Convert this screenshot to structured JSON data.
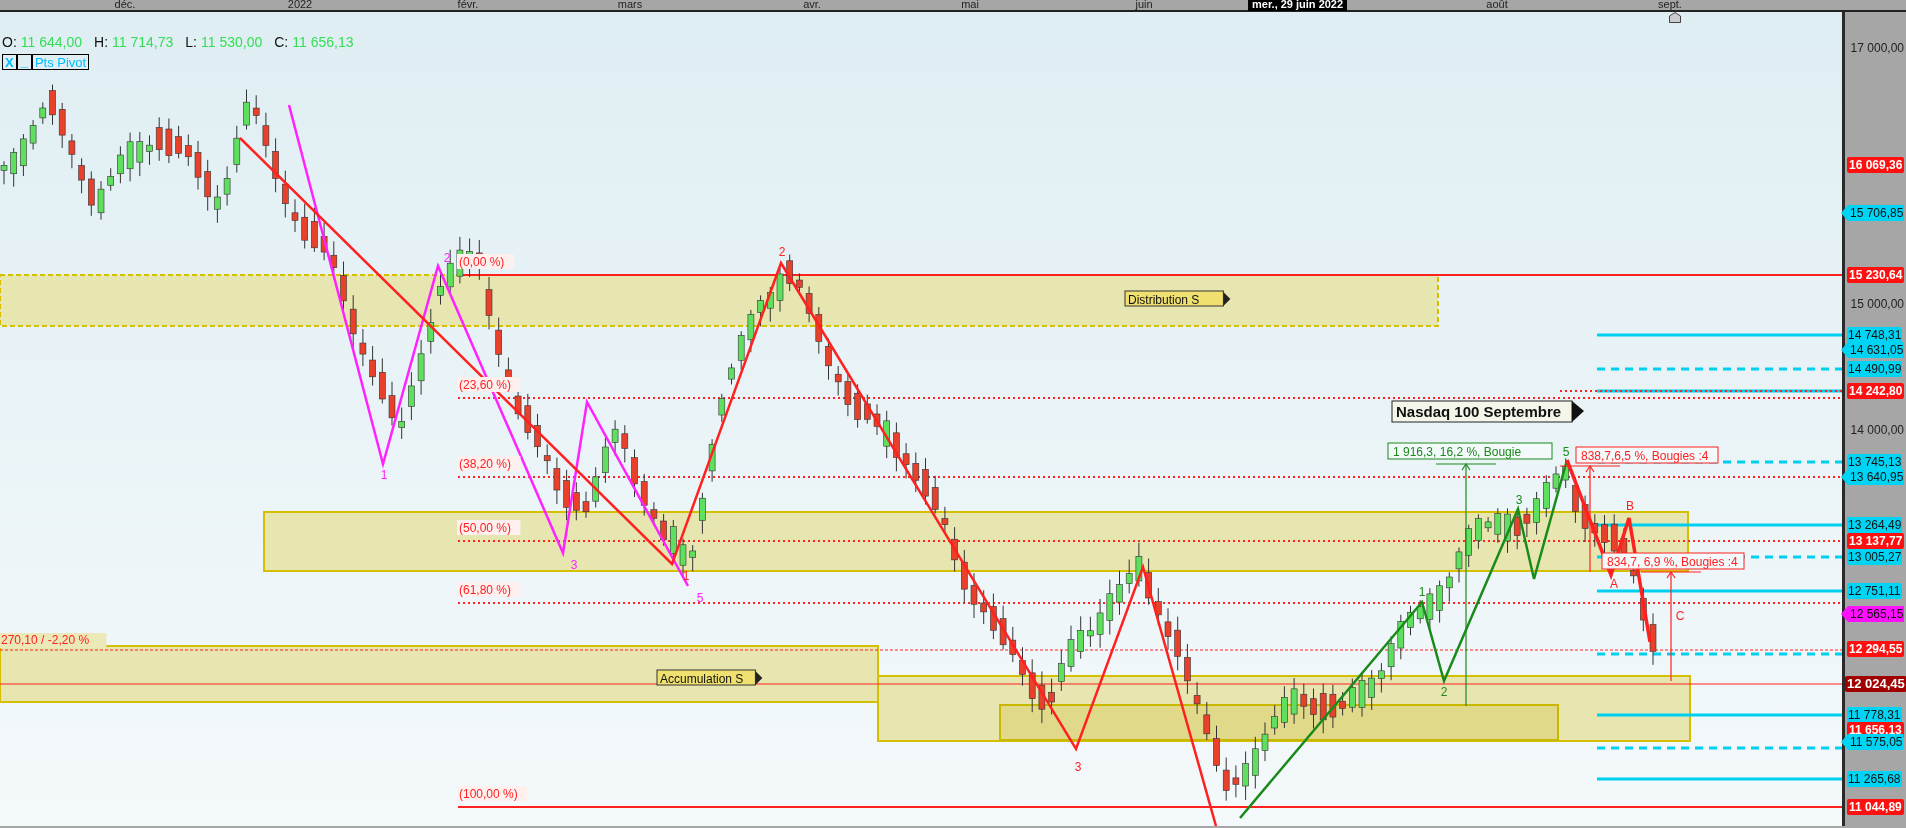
{
  "time_axis": {
    "labels": [
      "déc.",
      "2022",
      "févr.",
      "mars",
      "avr.",
      "mai",
      "juin",
      "août",
      "sept."
    ],
    "cursor_date": "mer., 29 juin 2022"
  },
  "ohlc": [
    {
      "label": "O:",
      "value": "11 644,00"
    },
    {
      "label": "H:",
      "value": "11 714,73"
    },
    {
      "label": "L:",
      "value": "11 530,00"
    },
    {
      "label": "C:",
      "value": "11 656,13"
    }
  ],
  "indicator_toolbar": {
    "close": "X",
    "minimize": "_",
    "name": "Pts Pivot"
  },
  "zone_labels": [
    "Distribution S",
    "Accumulation S"
  ],
  "fib_levels": [
    "(0,00 %)",
    "(23,60 %)",
    "(38,20 %)",
    "(50,00 %)",
    "(61,80 %)",
    "(100,00 %)"
  ],
  "extension_label": "270,10 / -2,20 %",
  "instrument_label": "Nasdaq 100 Septembre",
  "measurements": [
    {
      "text": "1 916,3, 16,2 %, Bougie",
      "kind": "up"
    },
    {
      "text": "838,7,6,5 %, Bougies :4",
      "kind": "down"
    },
    {
      "text": "834,7, 6,9 %, Bougies :4",
      "kind": "down"
    }
  ],
  "wave_labels": [
    {
      "text": "1",
      "kind": "magenta"
    },
    {
      "text": "2",
      "kind": "magenta"
    },
    {
      "text": "3",
      "kind": "magenta"
    },
    {
      "text": "5",
      "kind": "magenta"
    },
    {
      "text": "1",
      "kind": "red"
    },
    {
      "text": "2",
      "kind": "red"
    },
    {
      "text": "3",
      "kind": "red"
    },
    {
      "text": "1",
      "kind": "green"
    },
    {
      "text": "2",
      "kind": "green"
    },
    {
      "text": "3",
      "kind": "green"
    },
    {
      "text": "5",
      "kind": "green"
    },
    {
      "text": "A",
      "kind": "red"
    },
    {
      "text": "B",
      "kind": "red"
    },
    {
      "text": "C",
      "kind": "red"
    }
  ],
  "price_axis": [
    {
      "text": "17 000,00",
      "kind": "tick"
    },
    {
      "text": "16 069,36",
      "kind": "red"
    },
    {
      "text": "15 706,85",
      "kind": "cyan-pointer"
    },
    {
      "text": "15 230,64",
      "kind": "red"
    },
    {
      "text": "15 000,00",
      "kind": "tick"
    },
    {
      "text": "14 748,31",
      "kind": "cyan"
    },
    {
      "text": "14 631,05",
      "kind": "cyan-pointer"
    },
    {
      "text": "14 490,99",
      "kind": "cyan"
    },
    {
      "text": "14 242,80",
      "kind": "red"
    },
    {
      "text": "14 000,00",
      "kind": "tick"
    },
    {
      "text": "13 745,13",
      "kind": "cyan"
    },
    {
      "text": "13 640,95",
      "kind": "cyan-pointer"
    },
    {
      "text": "13 264,49",
      "kind": "cyan"
    },
    {
      "text": "13 137,77",
      "kind": "red"
    },
    {
      "text": "13 005,27",
      "kind": "cyan"
    },
    {
      "text": "12 751,11",
      "kind": "cyan"
    },
    {
      "text": "12 565,15",
      "kind": "magenta-pointer"
    },
    {
      "text": "12 294,55",
      "kind": "red"
    },
    {
      "text": "12 024,45",
      "kind": "darkred"
    },
    {
      "text": "11 778,31",
      "kind": "cyan"
    },
    {
      "text": "11 656,13",
      "kind": "red"
    },
    {
      "text": "11 575,05",
      "kind": "cyan-pointer"
    },
    {
      "text": "11 265,68",
      "kind": "cyan"
    },
    {
      "text": "11 044,89",
      "kind": "red"
    }
  ]
}
